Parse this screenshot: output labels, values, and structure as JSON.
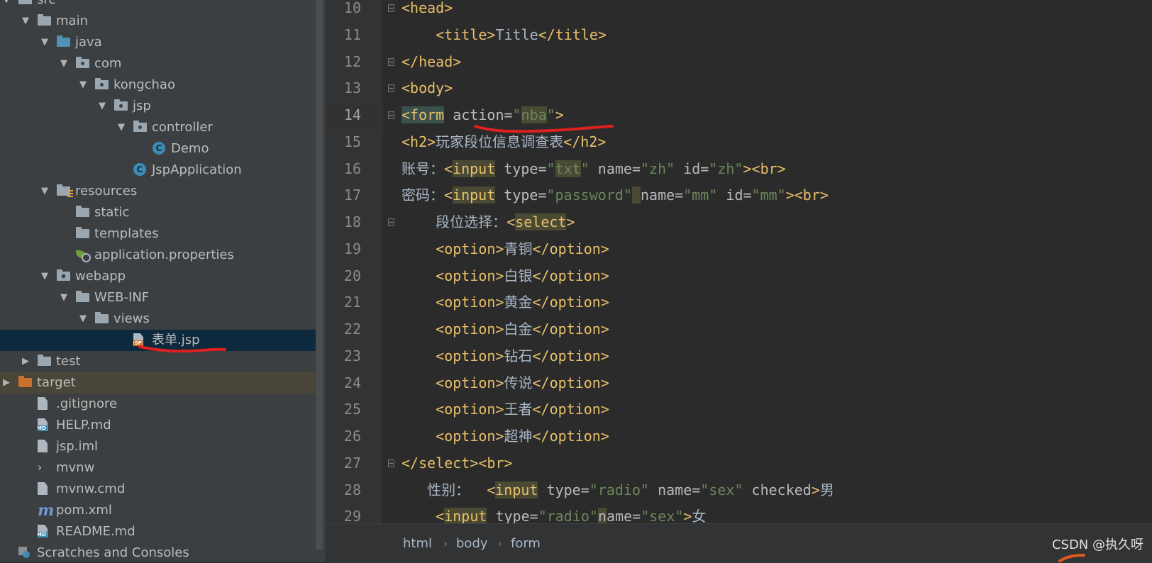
{
  "tree": [
    {
      "label": "src",
      "depth": 0,
      "arrow": "down",
      "icon": "folder-icon",
      "kind": "folder"
    },
    {
      "label": "main",
      "depth": 1,
      "arrow": "down",
      "icon": "folder-icon",
      "kind": "folder"
    },
    {
      "label": "java",
      "depth": 2,
      "arrow": "down",
      "icon": "source-folder-icon",
      "kind": "folder-blue"
    },
    {
      "label": "com",
      "depth": 3,
      "arrow": "down",
      "icon": "package-icon",
      "kind": "package"
    },
    {
      "label": "kongchao",
      "depth": 4,
      "arrow": "down",
      "icon": "package-icon",
      "kind": "package"
    },
    {
      "label": "jsp",
      "depth": 5,
      "arrow": "down",
      "icon": "package-icon",
      "kind": "package"
    },
    {
      "label": "controller",
      "depth": 6,
      "arrow": "down",
      "icon": "package-icon",
      "kind": "package"
    },
    {
      "label": "Demo",
      "depth": 7,
      "arrow": "none",
      "icon": "class-icon",
      "kind": "class"
    },
    {
      "label": "JspApplication",
      "depth": 6,
      "arrow": "none",
      "icon": "spring-boot-class-icon",
      "kind": "class"
    },
    {
      "label": "resources",
      "depth": 2,
      "arrow": "down",
      "icon": "resources-folder-icon",
      "kind": "resources"
    },
    {
      "label": "static",
      "depth": 3,
      "arrow": "none",
      "icon": "folder-icon",
      "kind": "folder"
    },
    {
      "label": "templates",
      "depth": 3,
      "arrow": "none",
      "icon": "folder-icon",
      "kind": "folder"
    },
    {
      "label": "application.properties",
      "depth": 3,
      "arrow": "none",
      "icon": "spring-properties-icon",
      "kind": "props"
    },
    {
      "label": "webapp",
      "depth": 2,
      "arrow": "down",
      "icon": "web-folder-icon",
      "kind": "web"
    },
    {
      "label": "WEB-INF",
      "depth": 3,
      "arrow": "down",
      "icon": "folder-icon",
      "kind": "folder"
    },
    {
      "label": "views",
      "depth": 4,
      "arrow": "down",
      "icon": "folder-icon",
      "kind": "folder"
    },
    {
      "label": "表单.jsp",
      "depth": 6,
      "arrow": "none",
      "icon": "jsp-file-icon",
      "kind": "jsp",
      "selected": true
    },
    {
      "label": "test",
      "depth": 1,
      "arrow": "right",
      "icon": "folder-icon",
      "kind": "folder"
    },
    {
      "label": "target",
      "depth": 0,
      "arrow": "right",
      "icon": "excluded-folder-icon",
      "kind": "folder-orange",
      "excluded": true
    },
    {
      "label": ".gitignore",
      "depth": 1,
      "arrow": "none",
      "icon": "gitignore-file-icon",
      "kind": "file"
    },
    {
      "label": "HELP.md",
      "depth": 1,
      "arrow": "none",
      "icon": "markdown-file-icon",
      "kind": "md"
    },
    {
      "label": "jsp.iml",
      "depth": 1,
      "arrow": "none",
      "icon": "iml-file-icon",
      "kind": "file"
    },
    {
      "label": "mvnw",
      "depth": 1,
      "arrow": "none",
      "icon": "shell-script-icon",
      "kind": "term"
    },
    {
      "label": "mvnw.cmd",
      "depth": 1,
      "arrow": "none",
      "icon": "text-file-icon",
      "kind": "file"
    },
    {
      "label": "pom.xml",
      "depth": 1,
      "arrow": "none",
      "icon": "maven-icon",
      "kind": "maven"
    },
    {
      "label": "README.md",
      "depth": 1,
      "arrow": "none",
      "icon": "markdown-file-icon",
      "kind": "md"
    },
    {
      "label": "Scratches and Consoles",
      "depth": 0,
      "arrow": "none",
      "icon": "scratches-icon",
      "kind": "scratch"
    }
  ],
  "editor": {
    "current_line": 14,
    "lines": [
      {
        "n": "10",
        "fold": true,
        "indent": "",
        "tokens": [
          [
            "tg",
            "<head>"
          ]
        ]
      },
      {
        "n": "11",
        "fold": false,
        "indent": "    ",
        "tokens": [
          [
            "tg",
            "<title>"
          ],
          [
            "tx",
            "Title"
          ],
          [
            "tg",
            "</title>"
          ]
        ]
      },
      {
        "n": "12",
        "fold": true,
        "indent": "",
        "tokens": [
          [
            "tg",
            "</head>"
          ]
        ]
      },
      {
        "n": "13",
        "fold": true,
        "indent": "",
        "tokens": [
          [
            "tg",
            "<body>"
          ]
        ]
      },
      {
        "n": "14",
        "fold": true,
        "indent": "",
        "tokens": [
          [
            "tg hl",
            "<form"
          ],
          [
            "at",
            " action="
          ],
          [
            "st",
            "\""
          ],
          [
            "st hl2",
            "nba"
          ],
          [
            "st",
            "\""
          ],
          [
            "tg",
            ">"
          ]
        ]
      },
      {
        "n": "15",
        "fold": false,
        "indent": "",
        "tokens": [
          [
            "tg",
            "<h2>"
          ],
          [
            "tx",
            "玩家段位信息调查表"
          ],
          [
            "tg",
            "</h2>"
          ]
        ]
      },
      {
        "n": "16",
        "fold": false,
        "indent": "",
        "tokens": [
          [
            "tx",
            "账号："
          ],
          [
            "tg",
            "<"
          ],
          [
            "tg hl2",
            "input"
          ],
          [
            "at",
            " type="
          ],
          [
            "st",
            "\""
          ],
          [
            "st hl2",
            "txt"
          ],
          [
            "st",
            "\""
          ],
          [
            "at",
            " name="
          ],
          [
            "st",
            "\"zh\""
          ],
          [
            "at",
            " id="
          ],
          [
            "st",
            "\"zh\""
          ],
          [
            "tg",
            "><br>"
          ]
        ]
      },
      {
        "n": "17",
        "fold": false,
        "indent": "",
        "tokens": [
          [
            "tx",
            "密码："
          ],
          [
            "tg",
            "<"
          ],
          [
            "tg hl2",
            "input"
          ],
          [
            "at",
            " type="
          ],
          [
            "st",
            "\"password\""
          ],
          [
            "at hl2",
            " "
          ],
          [
            "at",
            "name="
          ],
          [
            "st",
            "\"mm\""
          ],
          [
            "at",
            " id="
          ],
          [
            "st",
            "\"mm\""
          ],
          [
            "tg",
            "><br>"
          ]
        ]
      },
      {
        "n": "18",
        "fold": true,
        "indent": "    ",
        "tokens": [
          [
            "tx",
            "段位选择："
          ],
          [
            "tg",
            "<"
          ],
          [
            "tg hl2",
            "select"
          ],
          [
            "tg",
            ">"
          ]
        ]
      },
      {
        "n": "19",
        "fold": false,
        "indent": "    ",
        "tokens": [
          [
            "tg",
            "<option>"
          ],
          [
            "tx",
            "青铜"
          ],
          [
            "tg",
            "</option>"
          ]
        ]
      },
      {
        "n": "20",
        "fold": false,
        "indent": "    ",
        "tokens": [
          [
            "tg",
            "<option>"
          ],
          [
            "tx",
            "白银"
          ],
          [
            "tg",
            "</option>"
          ]
        ]
      },
      {
        "n": "21",
        "fold": false,
        "indent": "    ",
        "tokens": [
          [
            "tg",
            "<option>"
          ],
          [
            "tx",
            "黄金"
          ],
          [
            "tg",
            "</option>"
          ]
        ]
      },
      {
        "n": "22",
        "fold": false,
        "indent": "    ",
        "tokens": [
          [
            "tg",
            "<option>"
          ],
          [
            "tx",
            "白金"
          ],
          [
            "tg",
            "</option>"
          ]
        ]
      },
      {
        "n": "23",
        "fold": false,
        "indent": "    ",
        "tokens": [
          [
            "tg",
            "<option>"
          ],
          [
            "tx",
            "钻石"
          ],
          [
            "tg",
            "</option>"
          ]
        ]
      },
      {
        "n": "24",
        "fold": false,
        "indent": "    ",
        "tokens": [
          [
            "tg",
            "<option>"
          ],
          [
            "tx",
            "传说"
          ],
          [
            "tg",
            "</option>"
          ]
        ]
      },
      {
        "n": "25",
        "fold": false,
        "indent": "    ",
        "tokens": [
          [
            "tg",
            "<option>"
          ],
          [
            "tx",
            "王者"
          ],
          [
            "tg",
            "</option>"
          ]
        ]
      },
      {
        "n": "26",
        "fold": false,
        "indent": "    ",
        "tokens": [
          [
            "tg",
            "<option>"
          ],
          [
            "tx",
            "超神"
          ],
          [
            "tg",
            "</option>"
          ]
        ]
      },
      {
        "n": "27",
        "fold": true,
        "indent": "",
        "tokens": [
          [
            "tg",
            "</select><br>"
          ]
        ]
      },
      {
        "n": "28",
        "fold": false,
        "indent": "   ",
        "tokens": [
          [
            "tx",
            "性别：  "
          ],
          [
            "tg",
            "<"
          ],
          [
            "tg hl2",
            "input"
          ],
          [
            "at",
            " type="
          ],
          [
            "st",
            "\"radio\""
          ],
          [
            "at",
            " name="
          ],
          [
            "st",
            "\"sex\""
          ],
          [
            "at",
            " checked"
          ],
          [
            "tg",
            ">"
          ],
          [
            "tx",
            "男"
          ]
        ]
      },
      {
        "n": "29",
        "fold": false,
        "indent": "    ",
        "tokens": [
          [
            "tg",
            "<"
          ],
          [
            "tg hl2",
            "input"
          ],
          [
            "at",
            " type="
          ],
          [
            "st",
            "\"radio\""
          ],
          [
            "at hl2",
            "n"
          ],
          [
            "at",
            "ame="
          ],
          [
            "st",
            "\"sex\""
          ],
          [
            "tg",
            ">"
          ],
          [
            "tx",
            "女"
          ]
        ]
      }
    ]
  },
  "breadcrumb": [
    "html",
    "body",
    "form"
  ],
  "breadcrumb_separator": "›",
  "watermark": "CSDN @执久呀",
  "colors": {
    "tag": "#e8bf6a",
    "string": "#6a8759",
    "attribute": "#bababa",
    "text": "#a9b7c6",
    "annotation": "#e02020"
  }
}
